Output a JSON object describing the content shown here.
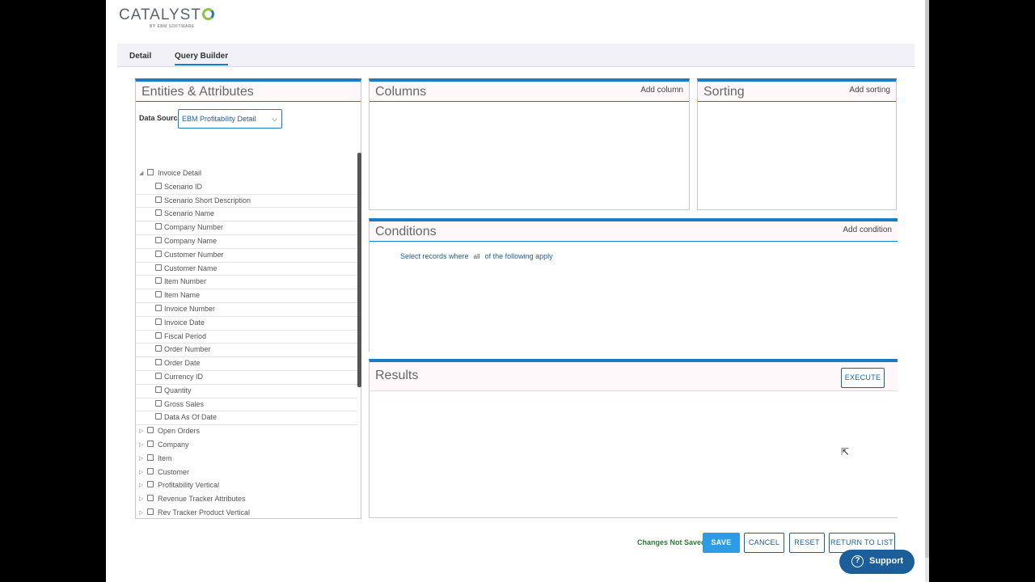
{
  "logo": {
    "word": "CATALYST",
    "sub": "BY EBM SOFTWARE"
  },
  "tabs": [
    {
      "label": "Detail",
      "active": false
    },
    {
      "label": "Query Builder",
      "active": true
    }
  ],
  "entities": {
    "title": "Entities & Attributes",
    "data_source_label": "Data Source",
    "data_source_value": "EBM Profitability Detail",
    "tree": [
      {
        "label": "Invoice Detail",
        "expanded": true,
        "children": [
          "Scenario ID",
          "Scenario Short Description",
          "Scenario Name",
          "Company Number",
          "Company Name",
          "Customer Number",
          "Customer Name",
          "Item Number",
          "Item Name",
          "Invoice Number",
          "Invoice Date",
          "Fiscal Period",
          "Order Number",
          "Order Date",
          "Currency ID",
          "Quantity",
          "Gross Sales",
          "Data As Of Date"
        ]
      },
      {
        "label": "Open Orders",
        "expanded": false
      },
      {
        "label": "Company",
        "expanded": false
      },
      {
        "label": "Item",
        "expanded": false
      },
      {
        "label": "Customer",
        "expanded": false
      },
      {
        "label": "Profitability Vertical",
        "expanded": false
      },
      {
        "label": "Revenue Tracker Attributes",
        "expanded": false
      },
      {
        "label": "Rev Tracker Product Vertical",
        "expanded": false
      }
    ]
  },
  "columns": {
    "title": "Columns",
    "action": "Add column"
  },
  "sorting": {
    "title": "Sorting",
    "action": "Add sorting"
  },
  "conditions": {
    "title": "Conditions",
    "action": "Add condition",
    "prefix": "Select records where",
    "mode": "all",
    "suffix": "of the following apply"
  },
  "results": {
    "title": "Results",
    "execute_label": "EXECUTE"
  },
  "footer": {
    "status": "Changes Not Saved",
    "save": "SAVE",
    "cancel": "CANCEL",
    "reset": "RESET",
    "return": "RETURN TO LIST"
  },
  "support": {
    "label": "Support",
    "icon": "?"
  },
  "colors": {
    "accent": "#1b7bc4",
    "primary_button": "#2e9be6",
    "support": "#1b5e9a",
    "status": "#2e7d32"
  }
}
